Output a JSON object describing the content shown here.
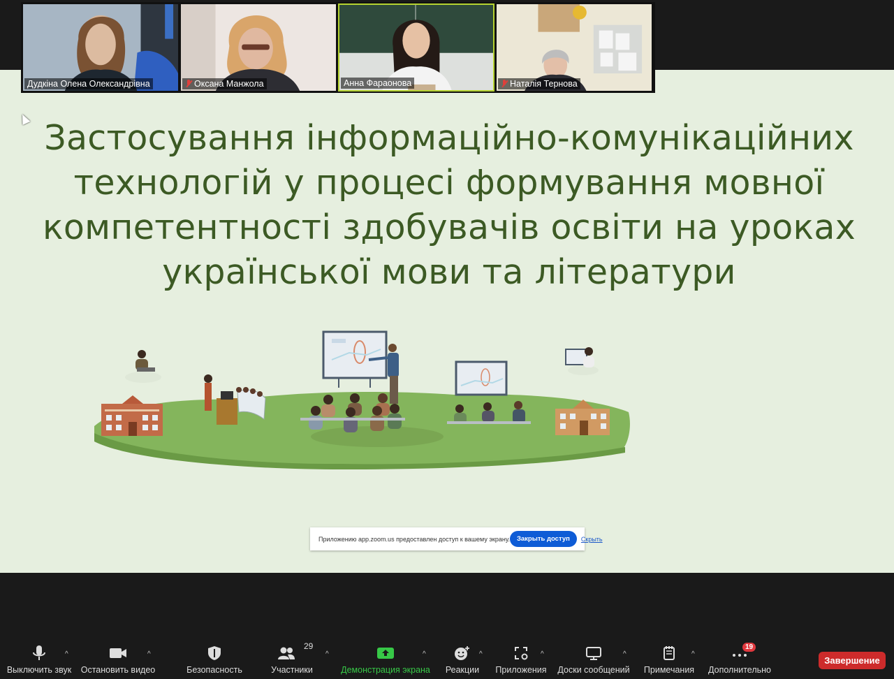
{
  "participants": [
    {
      "name": "Дудкіна Олена Олександрівна",
      "muted": false,
      "active": false
    },
    {
      "name": "Оксана Манжола",
      "muted": true,
      "active": false
    },
    {
      "name": "Анна Фараонова",
      "muted": false,
      "active": true
    },
    {
      "name": "Наталія Тернова",
      "muted": true,
      "active": false
    }
  ],
  "slide": {
    "title_lines": [
      "Застосування інформаційно-комунікаційних",
      "технологій у процесі формування мовної",
      "компетентності здобувачів освіти на уроках",
      "української мови та літератури"
    ],
    "text_color": "#3c5a24",
    "background": "#e6efdf"
  },
  "share_notice": {
    "text": "Приложению app.zoom.us предоставлен доступ к вашему экрану.",
    "stop_label": "Закрыть доступ",
    "hide_label": "Скрыть"
  },
  "toolbar": {
    "mute_label": "Выключить звук",
    "video_label": "Остановить видео",
    "security_label": "Безопасность",
    "participants_label": "Участники",
    "participants_count": "29",
    "share_label": "Демонстрация экрана",
    "reactions_label": "Реакции",
    "apps_label": "Приложения",
    "whiteboards_label": "Доски сообщений",
    "notes_label": "Примечания",
    "more_label": "Дополнительно",
    "more_badge": "19",
    "end_label": "Завершение",
    "share_color": "#37c847",
    "end_color": "#cd2b2b"
  }
}
